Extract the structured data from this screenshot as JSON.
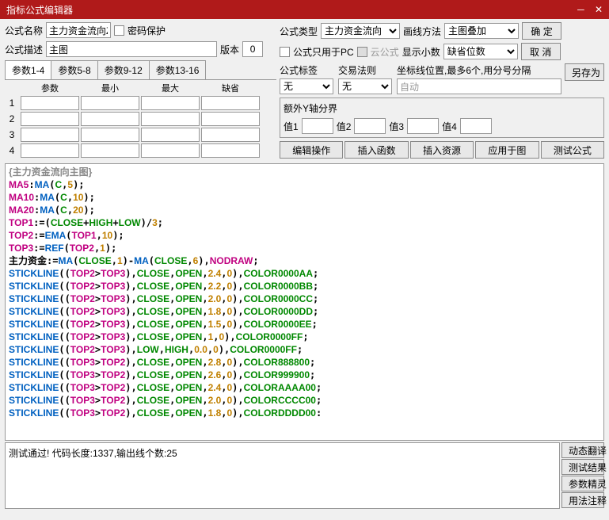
{
  "title": "指标公式编辑器",
  "header": {
    "name_lbl": "公式名称",
    "name_val": "主力资金流向Z",
    "pwd_lbl": "密码保护",
    "desc_lbl": "公式描述",
    "desc_val": "主图",
    "ver_lbl": "版本",
    "ver_val": "0",
    "type_lbl": "公式类型",
    "type_val": "主力资金流向",
    "draw_lbl": "画线方法",
    "draw_val": "主图叠加",
    "pc_lbl": "公式只用于PC",
    "cloud_lbl": "云公式",
    "dec_lbl": "显示小数",
    "dec_val": "缺省位数",
    "ok": "确 定",
    "cancel": "取 消",
    "saveas": "另存为",
    "tag_lbl": "公式标签",
    "tag_val": "无",
    "law_lbl": "交易法则",
    "law_val": "无",
    "coord_lbl": "坐标线位置,最多6个,用分号分隔",
    "coord_val": "自动",
    "yaxis_title": "额外Y轴分界",
    "v1": "值1",
    "v2": "值2",
    "v3": "值3",
    "v4": "值4",
    "btns": [
      "编辑操作",
      "插入函数",
      "插入资源",
      "应用于图",
      "测试公式"
    ]
  },
  "param_tabs": [
    "参数1-4",
    "参数5-8",
    "参数9-12",
    "参数13-16"
  ],
  "param_hdrs": [
    "参数",
    "最小",
    "最大",
    "缺省"
  ],
  "code_lines": [
    {
      "t": "title",
      "s": "{主力资金流向主图}"
    },
    {
      "t": "ma",
      "lhs": "MA5",
      "args": "C,5"
    },
    {
      "t": "ma",
      "lhs": "MA10",
      "args": "C,10"
    },
    {
      "t": "ma",
      "lhs": "MA20",
      "args": "C,20"
    },
    {
      "t": "top1"
    },
    {
      "t": "top2"
    },
    {
      "t": "top3"
    },
    {
      "t": "main"
    },
    {
      "t": "sl",
      "cmp": "TOP2>TOP3",
      "a": "CLOSE",
      "b": "OPEN",
      "w": "2.4",
      "clr": "COLOR0000AA"
    },
    {
      "t": "sl",
      "cmp": "TOP2>TOP3",
      "a": "CLOSE",
      "b": "OPEN",
      "w": "2.2",
      "clr": "COLOR0000BB"
    },
    {
      "t": "sl",
      "cmp": "TOP2>TOP3",
      "a": "CLOSE",
      "b": "OPEN",
      "w": "2.0",
      "clr": "COLOR0000CC"
    },
    {
      "t": "sl",
      "cmp": "TOP2>TOP3",
      "a": "CLOSE",
      "b": "OPEN",
      "w": "1.8",
      "clr": "COLOR0000DD"
    },
    {
      "t": "sl",
      "cmp": "TOP2>TOP3",
      "a": "CLOSE",
      "b": "OPEN",
      "w": "1.5",
      "clr": "COLOR0000EE"
    },
    {
      "t": "sl",
      "cmp": "TOP2>TOP3",
      "a": "CLOSE",
      "b": "OPEN",
      "w": "1",
      "clr": "COLOR0000FF"
    },
    {
      "t": "sl",
      "cmp": "TOP2>TOP3",
      "a": "LOW",
      "b": "HIGH",
      "w": "0.0",
      "clr": "COLOR0000FF"
    },
    {
      "t": "sl",
      "cmp": "TOP3>TOP2",
      "a": "CLOSE",
      "b": "OPEN",
      "w": "2.8",
      "clr": "COLOR888800"
    },
    {
      "t": "sl",
      "cmp": "TOP3>TOP2",
      "a": "CLOSE",
      "b": "OPEN",
      "w": "2.6",
      "clr": "COLOR999900"
    },
    {
      "t": "sl",
      "cmp": "TOP3>TOP2",
      "a": "CLOSE",
      "b": "OPEN",
      "w": "2.4",
      "clr": "COLORAAAA00"
    },
    {
      "t": "sl",
      "cmp": "TOP3>TOP2",
      "a": "CLOSE",
      "b": "OPEN",
      "w": "2.0",
      "clr": "COLORCCCC00"
    },
    {
      "t": "slp",
      "cmp": "TOP3>TOP2",
      "a": "CLOSE",
      "b": "OPEN",
      "w": "1.8",
      "clr": "COLORDDDD00"
    }
  ],
  "status": "测试通过! 代码长度:1337,输出线个数:25",
  "side_btns": [
    "动态翻译",
    "测试结果",
    "参数精灵",
    "用法注释"
  ]
}
